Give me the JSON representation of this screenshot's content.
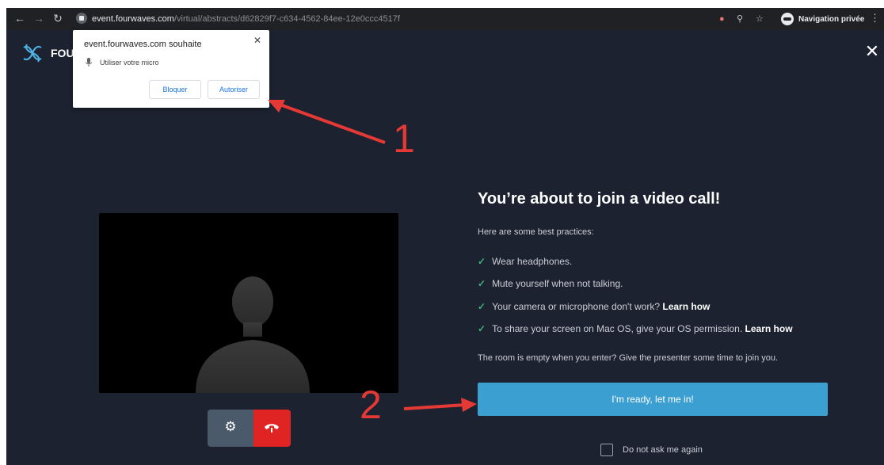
{
  "browser": {
    "url_host": "event.fourwaves.com",
    "url_path": "/virtual/abstracts/d62829f7-c634-4562-84ee-12e0ccc4517f",
    "profile_label": "Navigation privée"
  },
  "header": {
    "brand": "FOU"
  },
  "popup": {
    "title": "event.fourwaves.com souhaite",
    "permission": "Utiliser votre micro",
    "block_label": "Bloquer",
    "allow_label": "Autoriser"
  },
  "annotations": {
    "one": "1",
    "two": "2"
  },
  "join": {
    "title": "You’re about to join a video call!",
    "intro": "Here are some best practices:",
    "tips": [
      {
        "text": "Wear headphones.",
        "link": ""
      },
      {
        "text": "Mute yourself when not talking.",
        "link": ""
      },
      {
        "text": "Your camera or microphone don't work?",
        "link": "Learn how"
      },
      {
        "text": "To share your screen on Mac OS, give your OS permission.",
        "link": "Learn how"
      }
    ],
    "empty_note": "The room is empty when you enter? Give the presenter some time to join you.",
    "ready_label": "I'm ready, let me in!",
    "dont_ask_label": "Do not ask me again"
  },
  "colors": {
    "background": "#1c2230",
    "primary_button": "#3ba0d1",
    "hangup": "#e02323",
    "check": "#3fb27f",
    "annotation": "#e53935"
  }
}
